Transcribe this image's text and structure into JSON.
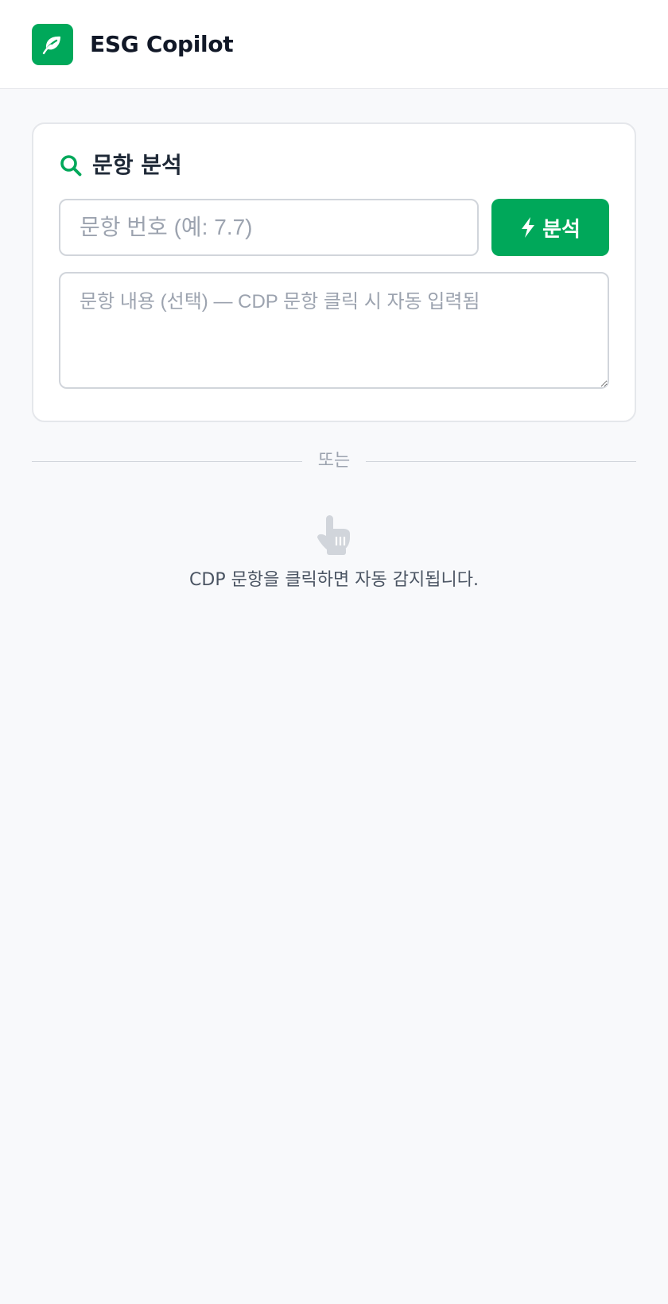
{
  "header": {
    "app_title": "ESG Copilot",
    "logo_icon": "leaf-icon",
    "brand_color": "#00a85a"
  },
  "analysis_card": {
    "title": "문항 분석",
    "title_icon": "search-icon",
    "question_number_input": {
      "placeholder": "문항 번호 (예: 7.7)",
      "value": ""
    },
    "analyze_button": {
      "label": "분석",
      "icon": "lightning-icon"
    },
    "question_content_input": {
      "placeholder": "문항 내용 (선택) — CDP 문항 클릭 시 자동 입력됨",
      "value": ""
    }
  },
  "divider": {
    "label": "또는"
  },
  "auto_detect_hint": {
    "icon": "pointing-hand-icon",
    "text": "CDP 문항을 클릭하면 자동 감지됩니다."
  }
}
